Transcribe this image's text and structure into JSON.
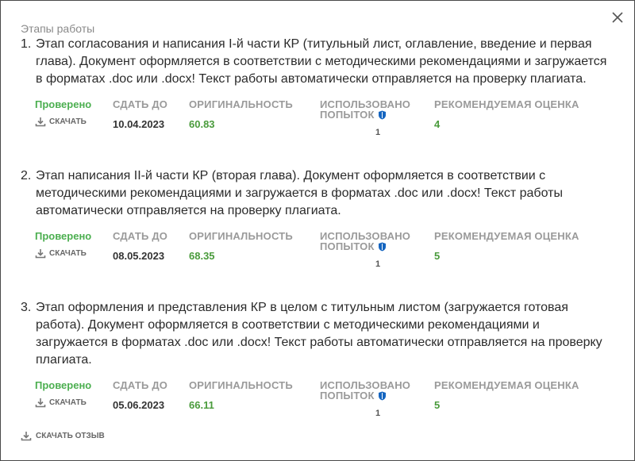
{
  "header": {
    "title": "Этапы работы"
  },
  "labels": {
    "due": "Сдать до",
    "originality": "Оригинальность",
    "attempts_line1": "Использовано",
    "attempts_line2": "попыток",
    "grade": "Рекомендуемая оценка",
    "download": "скачать"
  },
  "stages": [
    {
      "number": "1.",
      "text": "Этап согласования и написания I-й части КР (титульный лист, оглавление, введение и первая глава). Документ оформляется в соответствии с методическими рекомендациями и загружается в форматах .doc или .docx! Текст работы автоматически отправляется на проверку плагиата.",
      "status": "Проверено",
      "due": "10.04.2023",
      "originality": "60.83",
      "attempts": "1",
      "grade": "4"
    },
    {
      "number": "2.",
      "text": "Этап написания II-й части КР (вторая глава). Документ оформляется в соответствии с методическими рекомендациями и загружается в форматах .doc или .docx! Текст работы автоматически отправляется на проверку плагиата.",
      "status": "Проверено",
      "due": "08.05.2023",
      "originality": "68.35",
      "attempts": "1",
      "grade": "5"
    },
    {
      "number": "3.",
      "text": "Этап оформления и представления КР в целом с титульным листом (загружается готовая работа). Документ оформляется в соответствии с методическими рекомендациями и загружается в форматах .doc или .docx! Текст работы автоматически отправляется на проверку плагиата.",
      "status": "Проверено",
      "due": "05.06.2023",
      "originality": "66.11",
      "attempts": "1",
      "grade": "5"
    }
  ],
  "footer": {
    "download_review": "скачать отзыв"
  },
  "colors": {
    "accent_green": "#4caf50",
    "value_green": "#4a9b3c",
    "label_gray": "#9a9a9a"
  },
  "icons": [
    "close-icon",
    "download-icon",
    "shield-icon"
  ]
}
